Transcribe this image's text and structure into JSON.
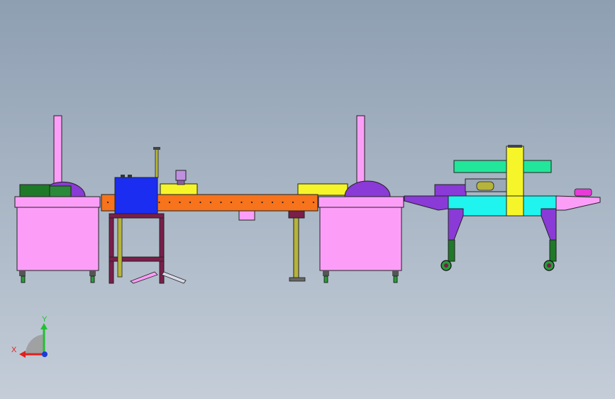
{
  "viewport": {
    "background_top": "#8e9fb2",
    "background_bottom": "#c4cdd8"
  },
  "triad": {
    "x_label": "X",
    "y_label": "Y",
    "x_color": "#e0201c",
    "y_color": "#22c030",
    "z_color": "#1a3cd8"
  },
  "palette": {
    "pink_cabinet": "#fc9ef8",
    "orange_conveyor": "#f7731c",
    "blue_box": "#1a2df0",
    "yellow": "#f5f52a",
    "cyan": "#1ff4ee",
    "green_roller": "#22e69a",
    "purple": "#8a3ad6",
    "maroon_frame": "#7a1e4a",
    "dark_green": "#1e7a28",
    "olive_leg": "#b6b43a"
  }
}
